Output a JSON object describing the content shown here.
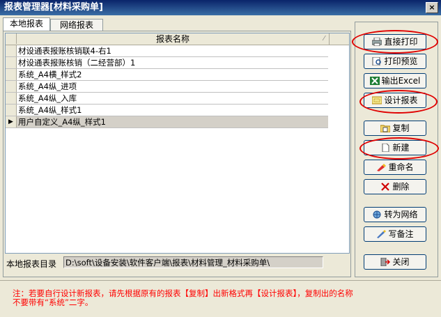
{
  "window": {
    "title": "报表管理器[材料采购单]",
    "close": "×"
  },
  "tabs": [
    {
      "label": "本地报表"
    },
    {
      "label": "网络报表"
    }
  ],
  "grid": {
    "header": "报表名称",
    "rows": [
      "材设通表报账核销联4-右1",
      "材设通表报账核销（二经营部）1",
      "系统_A4横_样式2",
      "系统_A4纵_进项",
      "系统_A4纵_入库",
      "系统_A4纵_样式1",
      "用户自定义_A4纵_样式1"
    ],
    "selected_row": "▶"
  },
  "path": {
    "label": "本地报表目录",
    "value": "D:\\soft\\设备安装\\软件客户端\\报表\\材料管理_材料采购单\\"
  },
  "buttons": {
    "print": "直接打印",
    "preview": "打印预览",
    "excel": "输出Excel",
    "design": "设计报表",
    "copy": "复制",
    "new": "新建",
    "rename": "重命名",
    "delete": "删除",
    "network": "转为网络",
    "note": "写备注",
    "close": "关闭"
  },
  "note": "注：若要自行设计新报表，请先根据原有的报表【复制】出新格式再【设计报表】，复制出的名称不要带有“系统”二字。",
  "colors": {
    "annotation": "#E00000",
    "note_text": "#FF0000"
  }
}
